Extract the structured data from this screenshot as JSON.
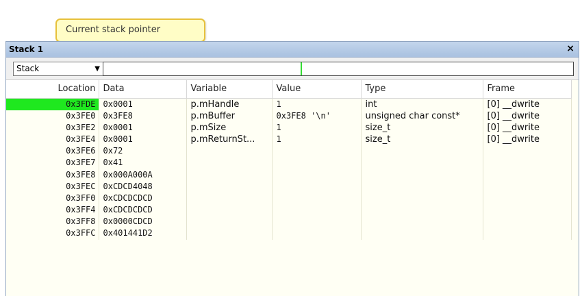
{
  "callout": {
    "text": "Current stack pointer"
  },
  "window": {
    "title": "Stack 1",
    "close_glyph": "×"
  },
  "toolbar": {
    "view_select": "Stack",
    "dropdown_glyph": "▼"
  },
  "columns": {
    "location": "Location",
    "data": "Data",
    "variable": "Variable",
    "value": "Value",
    "type": "Type",
    "frame": "Frame"
  },
  "rows": [
    {
      "location": "0x3FDE",
      "data": "0x0001",
      "variable": "p.mHandle",
      "value": "1",
      "type": "int",
      "frame": "[0] __dwrite"
    },
    {
      "location": "0x3FE0",
      "data": "0x3FE8",
      "variable": "p.mBuffer",
      "value": "0x3FE8 '\\n'",
      "type": "unsigned char const*",
      "frame": "[0] __dwrite"
    },
    {
      "location": "0x3FE2",
      "data": "0x0001",
      "variable": "p.mSize",
      "value": "1",
      "type": "size_t",
      "frame": "[0] __dwrite"
    },
    {
      "location": "0x3FE4",
      "data": "0x0001",
      "variable": "p.mReturnSt...",
      "value": "1",
      "type": "size_t",
      "frame": "[0] __dwrite"
    },
    {
      "location": "0x3FE6",
      "data": "0x72",
      "variable": "",
      "value": "",
      "type": "",
      "frame": ""
    },
    {
      "location": "0x3FE7",
      "data": "0x41",
      "variable": "",
      "value": "",
      "type": "",
      "frame": ""
    },
    {
      "location": "0x3FE8",
      "data": "0x000A000A",
      "variable": "",
      "value": "",
      "type": "",
      "frame": ""
    },
    {
      "location": "0x3FEC",
      "data": "0xCDCD4048",
      "variable": "",
      "value": "",
      "type": "",
      "frame": ""
    },
    {
      "location": "0x3FF0",
      "data": "0xCDCDCDCD",
      "variable": "",
      "value": "",
      "type": "",
      "frame": ""
    },
    {
      "location": "0x3FF4",
      "data": "0xCDCDCDCD",
      "variable": "",
      "value": "",
      "type": "",
      "frame": ""
    },
    {
      "location": "0x3FF8",
      "data": "0x0000CDCD",
      "variable": "",
      "value": "",
      "type": "",
      "frame": ""
    },
    {
      "location": "0x3FFC",
      "data": "0x401441D2",
      "variable": "",
      "value": "",
      "type": "",
      "frame": ""
    }
  ],
  "colors": {
    "stack_pointer_highlight": "#1fe81f",
    "grid_background": "#fffff4",
    "callout_background": "#fffdc6",
    "callout_border": "#e7c13a",
    "titlebar": "#b6cbe6"
  }
}
